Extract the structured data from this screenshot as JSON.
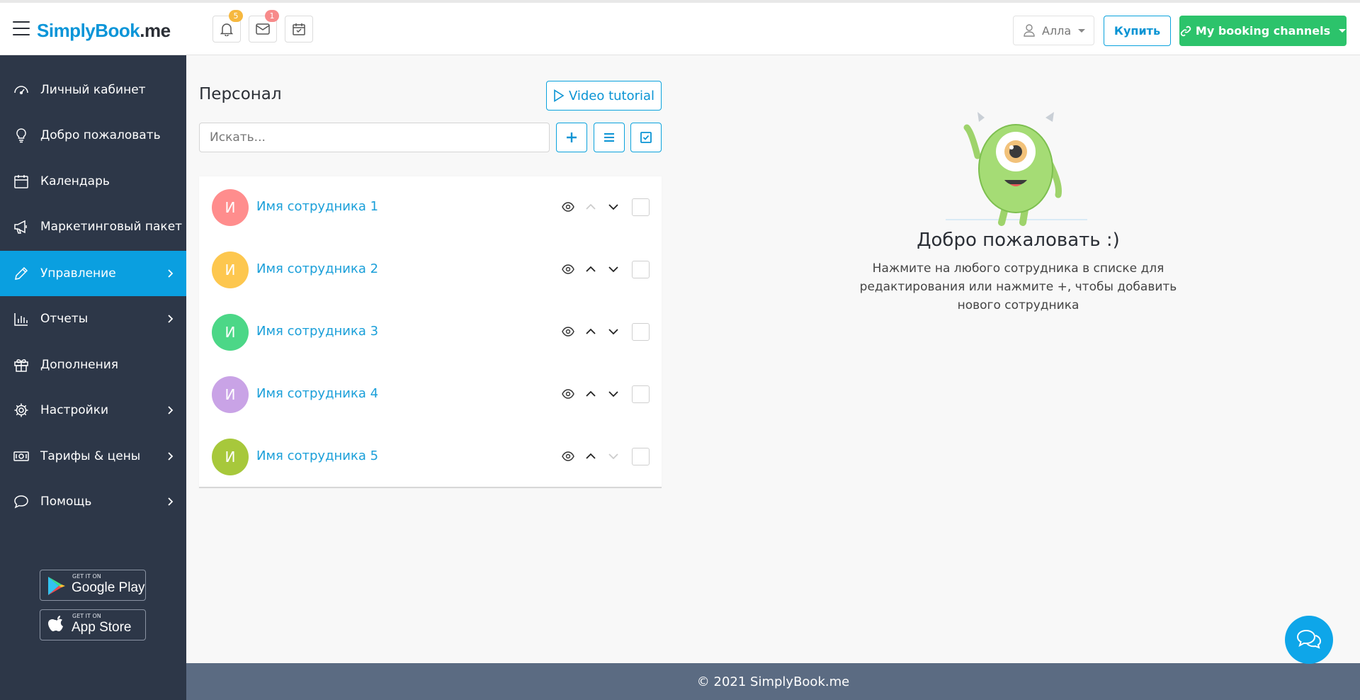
{
  "brand": {
    "logo_blue": "SimplyBook",
    "logo_dark": ".me"
  },
  "topbar": {
    "notifications_badge": "5",
    "messages_badge": "1",
    "user_name": "Алла",
    "buy_label": "Купить",
    "channels_label": "My booking channels"
  },
  "sidebar": {
    "items": [
      {
        "label": "Личный кабинет",
        "icon": "dashboard-icon"
      },
      {
        "label": "Добро пожаловать",
        "icon": "lightbulb-icon"
      },
      {
        "label": "Календарь",
        "icon": "calendar-icon"
      },
      {
        "label": "Маркетинговый пакет",
        "icon": "megaphone-icon"
      },
      {
        "label": "Управление",
        "icon": "pencil-icon",
        "active": true
      },
      {
        "label": "Отчеты",
        "icon": "bar-chart-icon"
      },
      {
        "label": "Дополнения",
        "icon": "gift-icon"
      },
      {
        "label": "Настройки",
        "icon": "gear-icon"
      },
      {
        "label": "Тарифы & цены",
        "icon": "money-icon"
      },
      {
        "label": "Помощь",
        "icon": "speech-bubble-icon"
      }
    ],
    "google_play": {
      "small": "GET IT ON",
      "big": "Google Play"
    },
    "app_store": {
      "small": "GET IT ON",
      "big": "App Store"
    }
  },
  "main": {
    "title": "Персонал",
    "video_label": "Video tutorial",
    "search_placeholder": "Искать...",
    "employees": [
      {
        "initial": "И",
        "name": "Имя сотрудника 1",
        "color": "#ff8d8d"
      },
      {
        "initial": "И",
        "name": "Имя сотрудника 2",
        "color": "#fdc74f"
      },
      {
        "initial": "И",
        "name": "Имя сотрудника 3",
        "color": "#4cd787"
      },
      {
        "initial": "И",
        "name": "Имя сотрудника 4",
        "color": "#c9a3e6"
      },
      {
        "initial": "И",
        "name": "Имя сотрудника 5",
        "color": "#a7c83b"
      }
    ]
  },
  "welcome": {
    "title": "Добро пожаловать :)",
    "text": "Нажмите на любого сотрудника в списке для редактирования или нажмите +, чтобы добавить нового сотрудника"
  },
  "footer": {
    "text": "© 2021 SimplyBook.me"
  },
  "colors": {
    "accent": "#0a9fe0",
    "sidebar": "#2d3748",
    "green": "#2cc36b",
    "footer": "#5b6b82"
  }
}
